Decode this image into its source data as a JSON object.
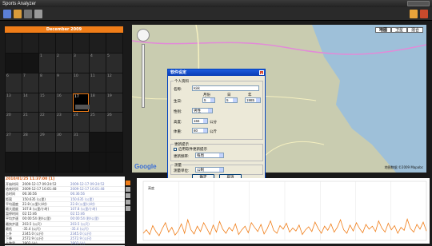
{
  "app": {
    "title": "Sports Analyzer"
  },
  "toolbar": {
    "icons": [
      "calendar-icon",
      "open-file-icon",
      "save-icon",
      "settings-icon",
      "help-icon",
      "exit-icon"
    ]
  },
  "calendar": {
    "month_title": "December 2009",
    "dow": [
      "",
      "",
      "",
      "",
      "",
      "",
      ""
    ],
    "weeks": [
      [
        "",
        "",
        "1",
        "2",
        "3",
        "4",
        "5"
      ],
      [
        "6",
        "7",
        "8",
        "9",
        "10",
        "11",
        "12"
      ],
      [
        "13",
        "14",
        "15",
        "16",
        "17",
        "18",
        "19"
      ],
      [
        "20",
        "21",
        "22",
        "23",
        "24",
        "25",
        "26"
      ],
      [
        "27",
        "28",
        "29",
        "30",
        "31",
        "",
        ""
      ],
      [
        "",
        "",
        "",
        "",
        "",
        "",
        ""
      ]
    ],
    "selected_day": "17"
  },
  "map": {
    "types": [
      "地图",
      "卫星",
      "混合"
    ],
    "active_type": "地图",
    "logo": "Google",
    "copyright": "地图数据 ©2009 Mapabc"
  },
  "dialog": {
    "title": "软件设定",
    "close_glyph": "x",
    "personal_group": "个人资料",
    "name_label": "名称:",
    "name_value": "Kirk",
    "birthday_label": "生日:",
    "month_label": "月份",
    "day_label": "日",
    "year_label": "年",
    "birth_month": "5",
    "birth_day": "5",
    "birth_year": "1985",
    "gender_label": "性别:",
    "gender_value": "男性",
    "height_label": "高度:",
    "height_value": "184",
    "height_unit": "公分",
    "weight_label": "体重:",
    "weight_value": "80",
    "weight_unit": "公斤",
    "update_group": "更新提示",
    "update_check": "启用软件更新提示",
    "update_freq_label": "更新频率:",
    "update_freq_value": "每周",
    "units_group": "测量",
    "units_label": "测量单位:",
    "units_value": "公制",
    "ok": "确定",
    "cancel": "取消"
  },
  "stats": {
    "title": "2010/01/25 11:37:00 [1]",
    "rows": [
      [
        "开始时间",
        "2009-12-17 09:24:52",
        "2009-12-17 09:24:52"
      ],
      [
        "结束时间",
        "2009-12-17 16:01:48",
        "2009-12-17 16:01:48"
      ],
      [
        "总时间",
        "06:36:56",
        "06:36:56"
      ],
      [
        "距离",
        "150.635 (公里)",
        "150.635 (公里)"
      ],
      [
        "平均速度",
        "22.8 (公里/小时)",
        "22.8 (公里/小时)"
      ],
      [
        "最大速度",
        "107.8 (公里/小时)",
        "107.8 (公里/小时)"
      ],
      [
        "暂停时间",
        "02:15:46",
        "02:15:46"
      ],
      [
        "平均步速",
        "00:00:54 (秒/公里)",
        "00:00:54 (秒/公里)"
      ],
      [
        "最快步速",
        "203.5 (公尺)",
        "203.5 (公尺)"
      ],
      [
        "最低",
        "-35.4 (公尺)",
        "-35.4 (公尺)"
      ],
      [
        "上升",
        "2345.0 (公尺)",
        "2345.0 (公尺)"
      ],
      [
        "下降",
        "2572.9 (公尺)",
        "2572.9 (公尺)"
      ],
      [
        "卡路里",
        "1903 (卡)",
        "1903 (卡)"
      ]
    ]
  },
  "chart": {
    "legend": "高度",
    "accent": "#f07d18"
  },
  "chart_data": {
    "type": "line",
    "title": "",
    "xlabel": "",
    "ylabel": "",
    "series": [
      {
        "name": "高度",
        "values": [
          12,
          18,
          10,
          25,
          15,
          8,
          20,
          30,
          14,
          22,
          9,
          16,
          28,
          12,
          35,
          18,
          11,
          24,
          15,
          30,
          20,
          10,
          26,
          14,
          32,
          19,
          12,
          22,
          16,
          28,
          10,
          18,
          24,
          13,
          30,
          22,
          15,
          27,
          11,
          20,
          33,
          17,
          12,
          25,
          19,
          29,
          14,
          21,
          16,
          26,
          10,
          18,
          23,
          15,
          31,
          20,
          12,
          24,
          17,
          28,
          14,
          22,
          35,
          18,
          12,
          26,
          16,
          30,
          20,
          13,
          27,
          19,
          24,
          15,
          33,
          21,
          14,
          29,
          18,
          25,
          12,
          22,
          17,
          36,
          20,
          14,
          27,
          19,
          31,
          16
        ]
      }
    ]
  }
}
